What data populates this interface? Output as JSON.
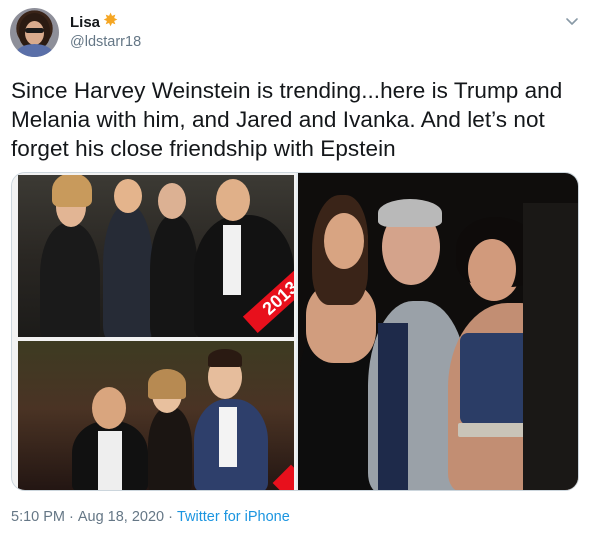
{
  "user": {
    "display_name": "Lisa",
    "badge_icon": "star-icon",
    "badge_color": "#f5a623",
    "handle": "@ldstarr18"
  },
  "tweet": {
    "text": "Since Harvey Weinstein is trending...here is Trump and Melania with him, and Jared and Ivanka. And let’s not forget his close friendship with Epstein"
  },
  "media": {
    "images": [
      {
        "name": "collage-photo",
        "overlay_text": "2013"
      },
      {
        "name": "epstein-photo"
      }
    ]
  },
  "footer": {
    "time": "5:10 PM",
    "separator": "·",
    "date": "Aug 18, 2020",
    "source": "Twitter for iPhone"
  },
  "colors": {
    "text": "#14171a",
    "secondary": "#657786",
    "link": "#1b95e0",
    "accent_red": "#e8101c"
  }
}
